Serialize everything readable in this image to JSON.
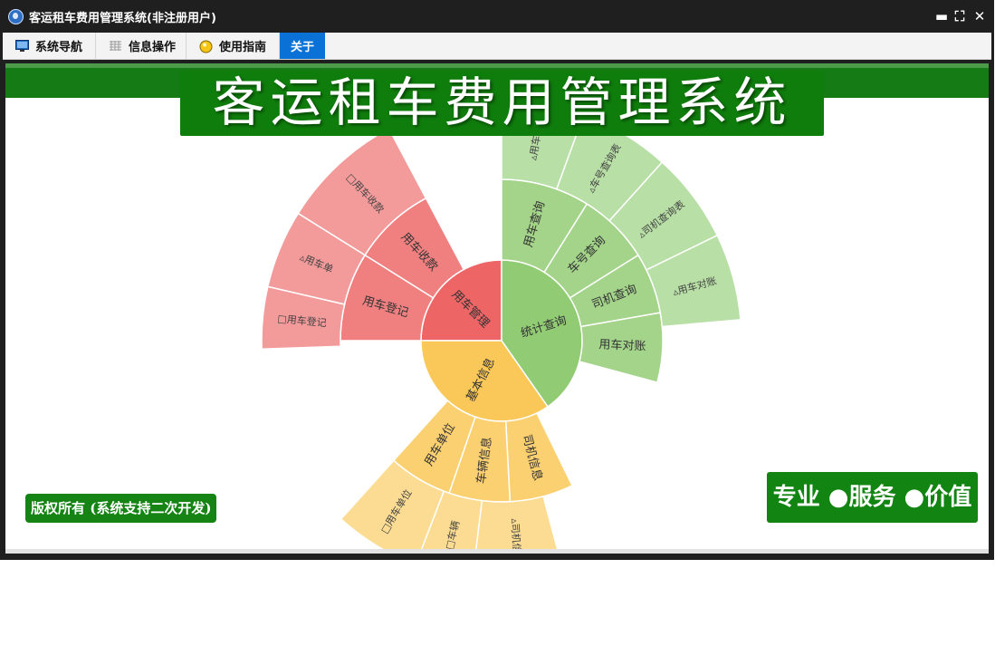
{
  "window": {
    "title": "客运租车费用管理系统(非注册用户)",
    "controls": [
      "▬",
      "⛶",
      "✕"
    ]
  },
  "menubar": {
    "tabs": [
      {
        "label": "系统导航",
        "icon": "monitor-icon",
        "active": false
      },
      {
        "label": "信息操作",
        "icon": "grid-icon",
        "active": false
      },
      {
        "label": "使用指南",
        "icon": "bulb-icon",
        "active": false
      },
      {
        "label": "关于",
        "icon": "",
        "active": true
      }
    ]
  },
  "banner": {
    "title": "客运租车费用管理系统"
  },
  "sunburst": {
    "center": [
      {
        "label": "用车管理",
        "color": "#ee6566"
      },
      {
        "label": "统计查询",
        "color": "#91cb74"
      },
      {
        "label": "基本信息",
        "color": "#fac858"
      }
    ],
    "ring1": [
      {
        "label": "用车收款",
        "parent": "用车管理"
      },
      {
        "label": "用车登记",
        "parent": "用车管理"
      },
      {
        "label": "用车查询",
        "parent": "统计查询"
      },
      {
        "label": "车号查询",
        "parent": "统计查询"
      },
      {
        "label": "司机查询",
        "parent": "统计查询"
      },
      {
        "label": "用车对账",
        "parent": "统计查询"
      },
      {
        "label": "司机信息",
        "parent": "基本信息"
      },
      {
        "label": "车辆信息",
        "parent": "基本信息"
      },
      {
        "label": "用车单位",
        "parent": "基本信息"
      }
    ],
    "ring2": [
      {
        "label": "□用车收款"
      },
      {
        "label": "▵用车单"
      },
      {
        "label": "□用车登记"
      },
      {
        "label": "▵用车查"
      },
      {
        "label": "▵车号查询表"
      },
      {
        "label": "▵司机查询表"
      },
      {
        "label": "▵用车对账"
      },
      {
        "label": "▵司机信息"
      },
      {
        "label": "□车辆"
      },
      {
        "label": "□用车单位"
      }
    ]
  },
  "footer": {
    "copyright": "版权所有 (系统支持二次开发)",
    "slogan": "专业 ●服务 ●价值"
  }
}
